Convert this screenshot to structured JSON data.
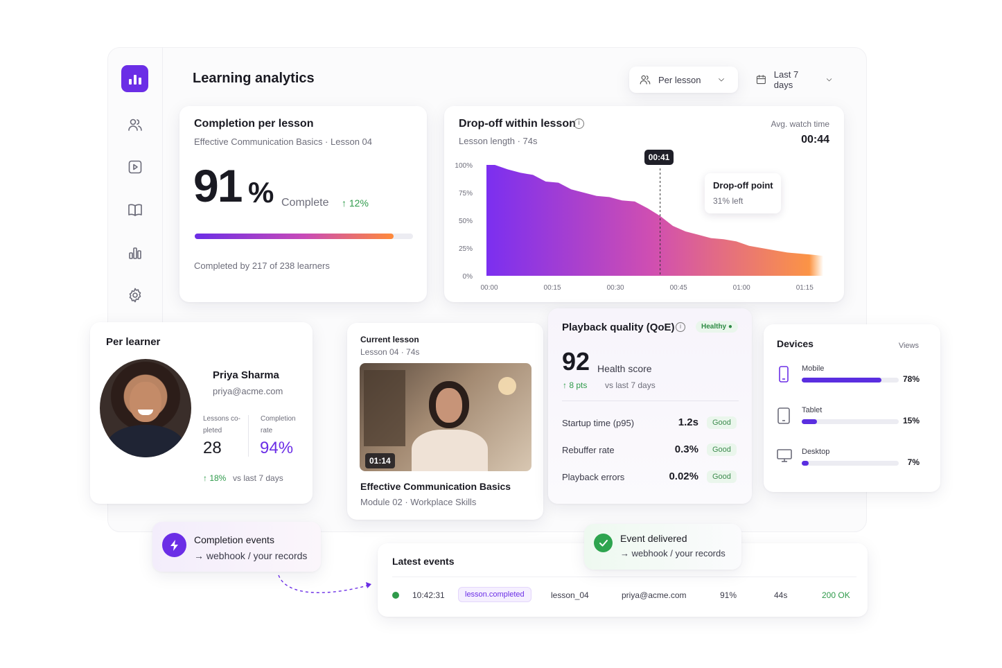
{
  "header": {
    "title": "Learning analytics",
    "view_select": "Per lesson",
    "range_select": "Last 7 days"
  },
  "sidebar": {
    "items": [
      "users-icon",
      "play-icon",
      "book-icon",
      "bar-chart-icon",
      "settings-icon"
    ]
  },
  "completion": {
    "title": "Completion per lesson",
    "subtitle": "Effective Communication Basics · Lesson 04",
    "value": "91",
    "unit": "%",
    "label": "Complete",
    "delta": "↑ 12%",
    "progress": 0.91,
    "footer": "Completed by 217 of 238 learners"
  },
  "dropoff": {
    "title": "Drop-off within lesson",
    "subtitle": "Lesson length · 74s",
    "avg_label": "Avg. watch time",
    "avg_value": "00:44",
    "marker_label": "00:41",
    "tooltip_title": "Drop-off point",
    "tooltip_value": "31% left"
  },
  "chart_data": {
    "type": "area",
    "title": "Drop-off within lesson",
    "x_ticks": [
      "00:00",
      "00:15",
      "00:30",
      "00:45",
      "01:00",
      "01:15"
    ],
    "y_ticks": [
      "100%",
      "75%",
      "50%",
      "25%",
      "0%"
    ],
    "x": [
      0,
      2,
      5,
      8,
      11,
      14,
      17,
      20,
      23,
      26,
      29,
      32,
      35,
      38,
      41,
      44,
      47,
      50,
      53,
      56,
      59,
      62,
      65,
      68,
      71,
      74,
      77,
      79.5
    ],
    "y": [
      100,
      100,
      96,
      93,
      91,
      85,
      84,
      78,
      75,
      72,
      71,
      68,
      67,
      61,
      54,
      45,
      40,
      37,
      34,
      33,
      31,
      27,
      25,
      23,
      21,
      20,
      19,
      18
    ],
    "xlim": [
      0,
      79.5
    ],
    "ylim": [
      0,
      100
    ],
    "marker_x": 41,
    "colors": [
      "#7b2ff0",
      "#d14fb0",
      "#ff9a3c"
    ]
  },
  "learner": {
    "section": "Per learner",
    "name": "Priya Sharma",
    "email": "priya@acme.com",
    "lessons_label_1": "Lessons co-",
    "lessons_label_2": "pleted",
    "lessons_value": "28",
    "rate_label_1": "Completion",
    "rate_label_2": "rate",
    "rate_value": "94%",
    "delta": "↑ 18%",
    "delta_suffix": "vs last 7 days"
  },
  "current_lesson": {
    "label": "Current lesson",
    "meta": "Lesson 04 · 74s",
    "timestamp": "01:14",
    "title": "Effective Communication Basics",
    "module": "Module 02 · Workplace Skills"
  },
  "qoe": {
    "title": "Playback quality (QoE)",
    "status": "Healthy",
    "score": "92",
    "score_label": "Health score",
    "delta": "↑ 8 pts",
    "delta_suffix": "vs last 7 days",
    "rows": [
      {
        "label": "Startup time (p95)",
        "value": "1.2s",
        "badge": "Good"
      },
      {
        "label": "Rebuffer rate",
        "value": "0.3%",
        "badge": "Good"
      },
      {
        "label": "Playback errors",
        "value": "0.02%",
        "badge": "Good"
      }
    ]
  },
  "devices": {
    "title": "Devices",
    "col": "Views",
    "items": [
      {
        "label": "Mobile",
        "value": "78%",
        "fraction": 0.78
      },
      {
        "label": "Tablet",
        "value": "15%",
        "fraction": 0.15
      },
      {
        "label": "Desktop",
        "value": "7%",
        "fraction": 0.07
      }
    ]
  },
  "webhook": {
    "title": "Completion events",
    "sub": "→ webhook / your records"
  },
  "delivered": {
    "title": "Event delivered",
    "sub": "→ webhook / your records"
  },
  "events": {
    "title": "Latest events",
    "row": {
      "time": "10:42:31",
      "type": "lesson.completed",
      "lesson": "lesson_04",
      "email": "priya@acme.com",
      "pct": "91%",
      "dur": "44s",
      "status": "200 OK"
    }
  }
}
